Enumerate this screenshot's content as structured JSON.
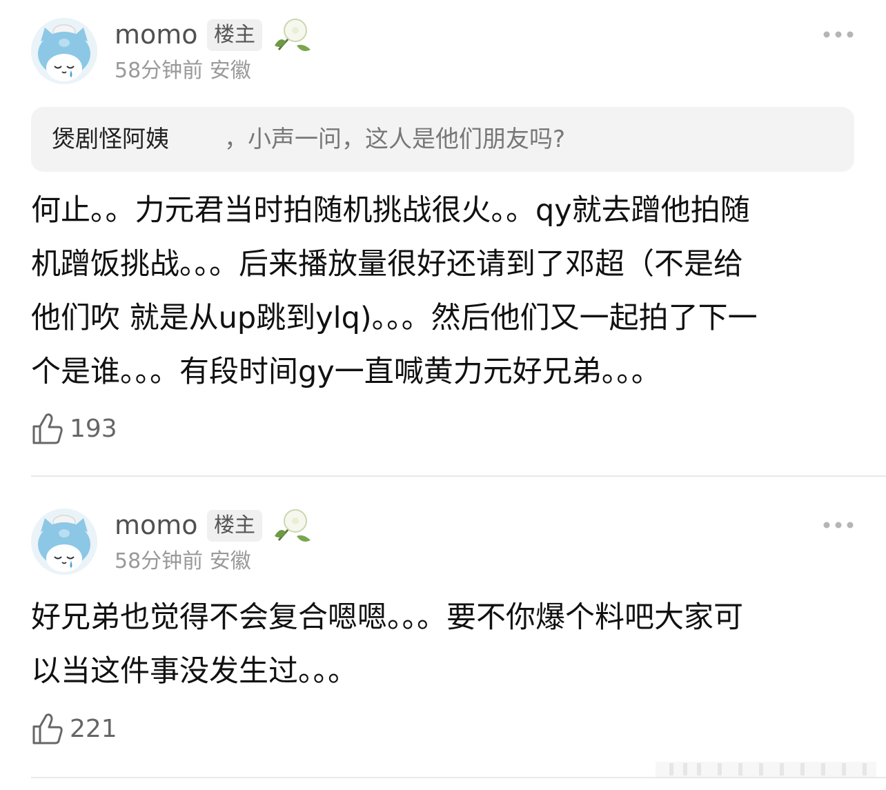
{
  "posts": [
    {
      "username": "momo",
      "badge": "楼主",
      "time": "58分钟前",
      "location": "安徽",
      "quote": {
        "user": "煲剧怪阿姨",
        "text": "，小声一问，这人是他们朋友吗?"
      },
      "lines": [
        "何止。。力元君当时拍随机挑战很火。。qy就去蹭他拍随",
        "机蹭饭挑战。。。后来播放量很好还请到了邓超（不是给",
        "他们吹 就是从up跳到ylq)。。。然后他们又一起拍了下一",
        "个是谁。。。有段时间gy一直喊黄力元好兄弟。。。"
      ],
      "likes": "193"
    },
    {
      "username": "momo",
      "badge": "楼主",
      "time": "58分钟前",
      "location": "安徽",
      "lines": [
        "好兄弟也觉得不会复合嗯嗯。。。要不你爆个料吧大家可",
        "以当这件事没发生过。。。"
      ],
      "likes": "221"
    }
  ],
  "icons": {
    "more": "more-dots-icon",
    "like": "thumbs-up-icon",
    "flower": "morning-glory-sticker",
    "avatar": "blue-cat-avatar"
  },
  "colors": {
    "username": "#505050",
    "meta": "#999999",
    "badge_bg": "#f0f0f0",
    "quote_bg": "#f3f3f3",
    "divider": "#e8e8e8"
  }
}
